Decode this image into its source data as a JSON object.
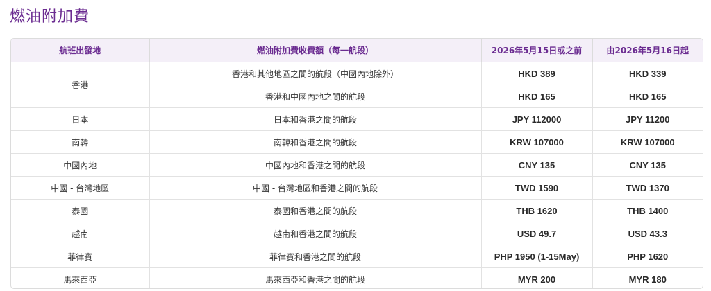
{
  "page": {
    "title": "燃油附加費"
  },
  "table": {
    "headers": {
      "origin": "航班出發地",
      "sector": "燃油附加費收費額（每一航段）",
      "before": "2026年5月15日或之前",
      "after": "由2026年5月16日起"
    },
    "rows": [
      {
        "origin": "香港",
        "sector": "香港和其他地區之間的航段（中國內地除外）",
        "before": "HKD 389",
        "after": "HKD 339"
      },
      {
        "origin": "",
        "sector": "香港和中國內地之間的航段",
        "before": "HKD 165",
        "after": "HKD 165"
      },
      {
        "origin": "日本",
        "sector": "日本和香港之間的航段",
        "before": "JPY 112000",
        "after": "JPY 11200"
      },
      {
        "origin": "南韓",
        "sector": "南韓和香港之間的航段",
        "before": "KRW 107000",
        "after": "KRW 107000"
      },
      {
        "origin": "中國內地",
        "sector": "中國內地和香港之間的航段",
        "before": "CNY 135",
        "after": "CNY 135"
      },
      {
        "origin": "中國 - 台灣地區",
        "sector": "中國 - 台灣地區和香港之間的航段",
        "before": "TWD 1590",
        "after": "TWD 1370"
      },
      {
        "origin": "泰國",
        "sector": "泰國和香港之間的航段",
        "before": "THB 1620",
        "after": "THB 1400"
      },
      {
        "origin": "越南",
        "sector": "越南和香港之間的航段",
        "before": "USD 49.7",
        "after": "USD 43.3"
      },
      {
        "origin": "菲律賓",
        "sector": "菲律賓和香港之間的航段",
        "before": "PHP 1950 (1-15May)",
        "after": "PHP 1620"
      },
      {
        "origin": "馬來西亞",
        "sector": "馬來西亞和香港之間的航段",
        "before": "MYR 200",
        "after": "MYR 180"
      }
    ]
  },
  "colors": {
    "accent": "#6b2c91",
    "header_bg": "#f4eff8",
    "border": "#dcdcdc"
  }
}
